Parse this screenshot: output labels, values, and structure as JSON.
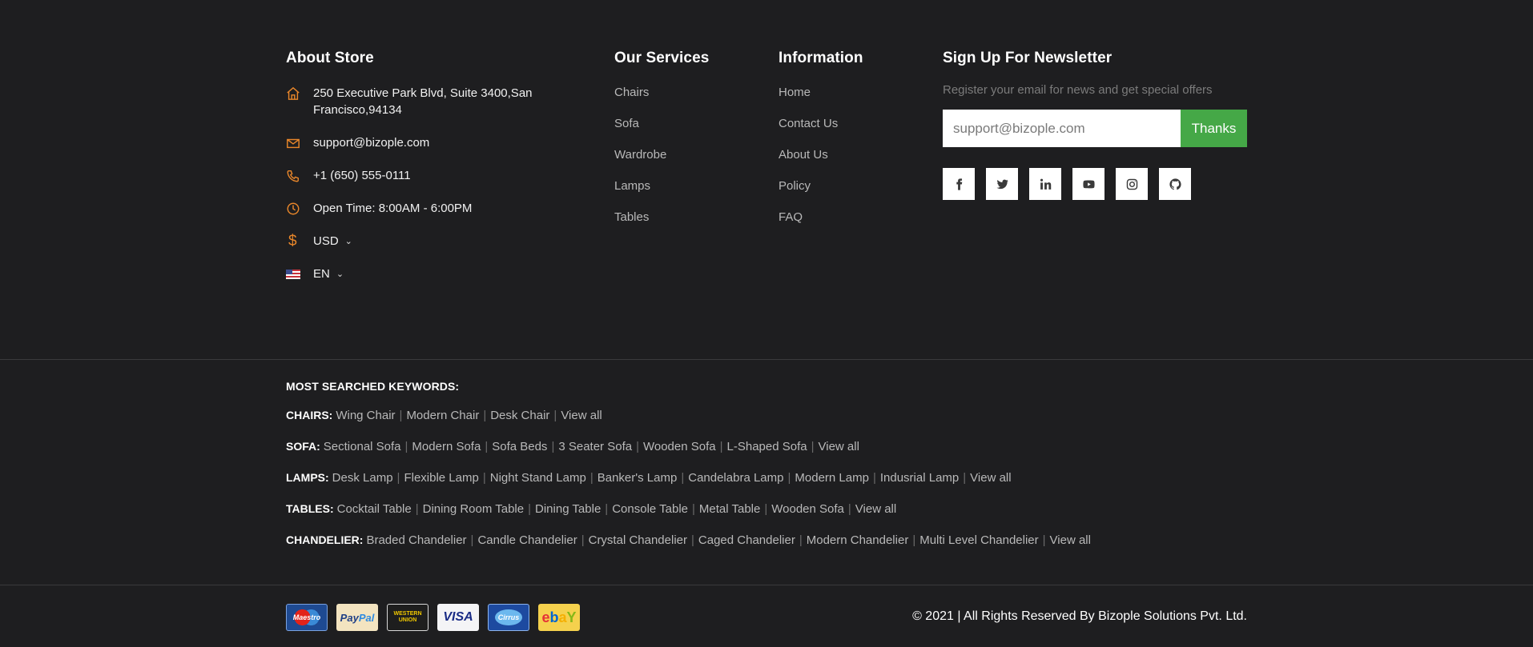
{
  "about": {
    "title": "About Store",
    "address": "250 Executive Park Blvd, Suite 3400,San Francisco,94134",
    "email": "support@bizople.com",
    "phone": "+1 (650) 555-0111",
    "hours": "Open Time: 8:00AM - 6:00PM",
    "currency": "USD",
    "language": "EN"
  },
  "services": {
    "title": "Our Services",
    "items": [
      "Chairs",
      "Sofa",
      "Wardrobe",
      "Lamps",
      "Tables"
    ]
  },
  "information": {
    "title": "Information",
    "items": [
      "Home",
      "Contact Us",
      "About Us",
      "Policy",
      "FAQ"
    ]
  },
  "newsletter": {
    "title": "Sign Up For Newsletter",
    "text": "Register your email for news and get special offers",
    "placeholder": "support@bizople.com",
    "button": "Thanks",
    "socials": [
      "facebook-icon",
      "twitter-icon",
      "linkedin-icon",
      "youtube-icon",
      "instagram-icon",
      "github-icon"
    ]
  },
  "keywords": {
    "title": "MOST SEARCHED KEYWORDS:",
    "groups": [
      {
        "label": "CHAIRS:",
        "items": [
          "Wing Chair",
          "Modern Chair",
          "Desk Chair",
          "View all"
        ]
      },
      {
        "label": "SOFA:",
        "items": [
          "Sectional Sofa",
          "Modern Sofa",
          "Sofa Beds",
          "3 Seater Sofa",
          "Wooden Sofa",
          "L-Shaped Sofa",
          "View all"
        ]
      },
      {
        "label": "LAMPS:",
        "items": [
          "Desk Lamp",
          "Flexible Lamp",
          "Night Stand Lamp",
          "Banker's Lamp",
          "Candelabra Lamp",
          "Modern Lamp",
          "Indusrial Lamp",
          "View all"
        ]
      },
      {
        "label": "TABLES:",
        "items": [
          "Cocktail Table",
          "Dining Room Table",
          "Dining Table",
          "Console Table",
          "Metal Table",
          "Wooden Sofa",
          "View all"
        ]
      },
      {
        "label": "CHANDELIER:",
        "items": [
          "Braded Chandelier",
          "Candle Chandelier",
          "Crystal Chandelier",
          "Caged Chandelier",
          "Modern Chandelier",
          "Multi Level Chandelier",
          "View all"
        ]
      }
    ]
  },
  "payments": {
    "maestro": "Maestro",
    "paypal_a": "Pay",
    "paypal_b": "Pal",
    "wu_a": "WESTERN",
    "wu_b": "UNION",
    "visa": "VISA",
    "cirrus": "Cirrus",
    "ebay_e": "e",
    "ebay_b": "b",
    "ebay_a": "a",
    "ebay_y": "Y"
  },
  "copyright": "© 2021 | All Rights Reserved By Bizople Solutions Pvt. Ltd.",
  "colors": {
    "background": "#1e1e20",
    "accent": "#e8862a",
    "button": "#45a847"
  }
}
